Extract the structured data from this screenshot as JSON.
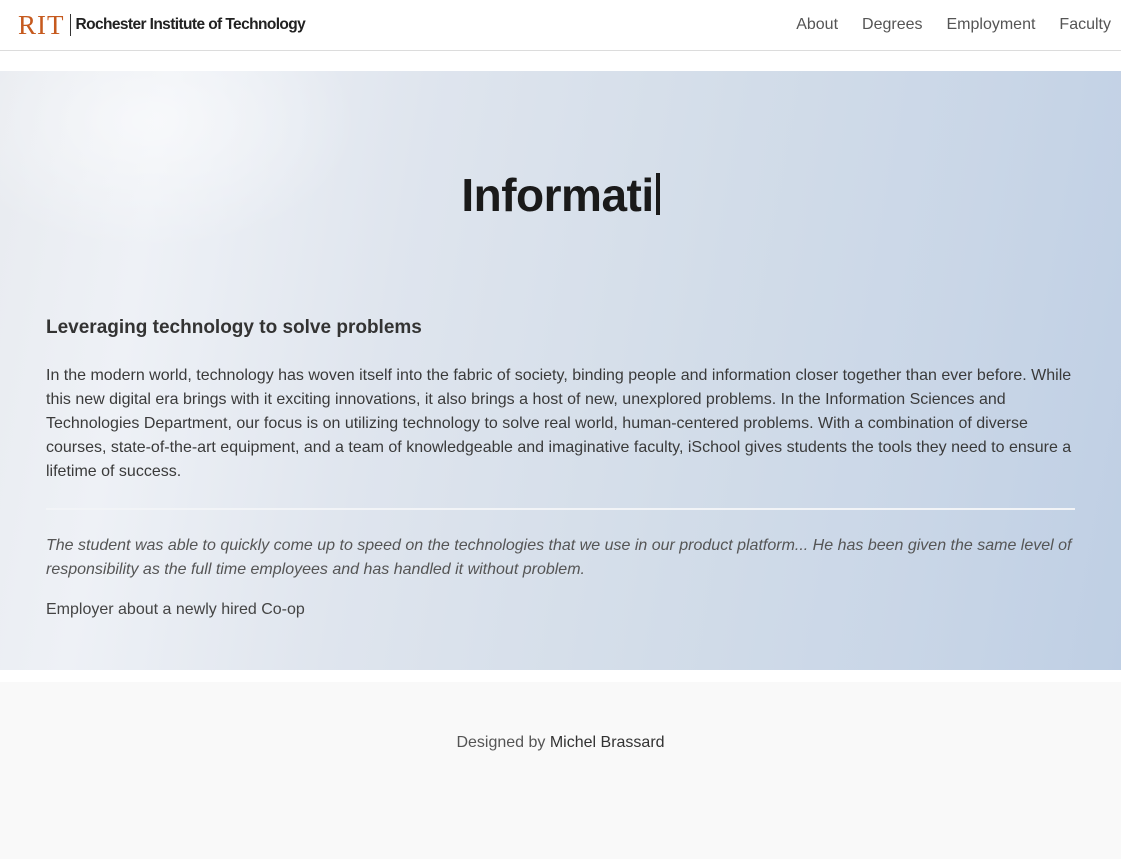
{
  "header": {
    "logo_mark": "RIT",
    "logo_text": "Rochester Institute of Technology",
    "nav": [
      {
        "label": "About"
      },
      {
        "label": "Degrees"
      },
      {
        "label": "Employment"
      },
      {
        "label": "Faculty"
      }
    ]
  },
  "hero": {
    "title": "Informati",
    "heading": "Leveraging technology to solve problems",
    "body": "In the modern world, technology has woven itself into the fabric of society, binding people and information closer together than ever before. While this new digital era brings with it exciting innovations, it also brings a host of new, unexplored problems. In the Information Sciences and Technologies Department, our focus is on utilizing technology to solve real world, human-centered problems. With a combination of diverse courses, state-of-the-art equipment, and a team of knowledgeable and imaginative faculty, iSchool gives students the tools they need to ensure a lifetime of success.",
    "quote": "The student was able to quickly come up to speed on the technologies that we use in our product platform... He has been given the same level of responsibility as the full time employees and has handled it without problem.",
    "quote_attribution": "Employer about a newly hired Co-op"
  },
  "footer": {
    "prefix": "Designed by",
    "author": "Michel Brassard"
  },
  "colors": {
    "brand": "#c65a1e",
    "hero_start": "#e8ebf0",
    "hero_end": "#bfcfe4"
  }
}
